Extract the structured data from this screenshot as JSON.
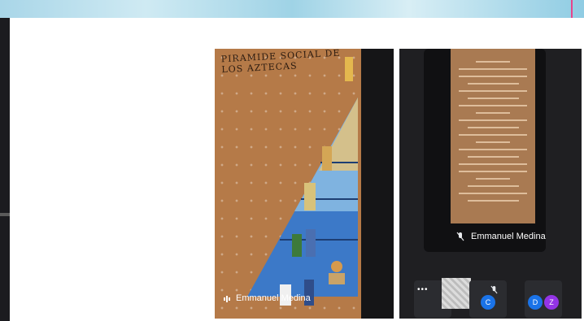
{
  "tiles": [
    {
      "artwork_heading": "PIRAMIDE SOCIAL DE LOS AZTECAS",
      "participant_name": "Emmanuel Medina"
    },
    {
      "participant_name": "Emmanuel Medina",
      "avatars": [
        {
          "initial": "C",
          "color": "#1a73e8"
        },
        {
          "initial": "D",
          "color": "#1a73e8"
        },
        {
          "initial": "Z",
          "color": "#9334e6"
        }
      ]
    }
  ],
  "icons": [
    "audio-indicator-icon",
    "mic-off-icon",
    "more-options-icon"
  ]
}
